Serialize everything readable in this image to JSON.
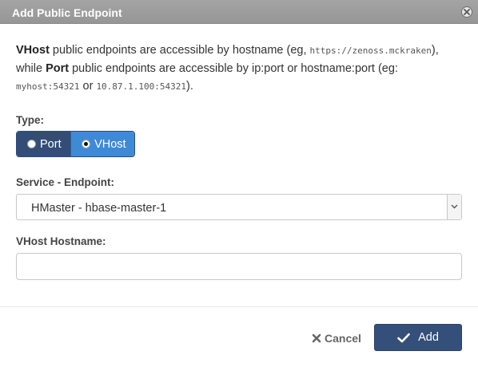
{
  "dialog": {
    "title": "Add Public Endpoint"
  },
  "intro": {
    "vhost_word": "VHost",
    "text1": " public endpoints are accessible by hostname (eg, ",
    "example_host": "https://zenoss.mckraken",
    "text2": "), while ",
    "port_word": "Port",
    "text3": " public endpoints are accessible by ip:port or hostname:port (eg: ",
    "example_port1": "myhost:54321",
    "text4": " or ",
    "example_port2": "10.87.1.100:54321",
    "text5": ")."
  },
  "type": {
    "label": "Type:",
    "options": [
      {
        "label": "Port",
        "selected": false
      },
      {
        "label": "VHost",
        "selected": true
      }
    ]
  },
  "service": {
    "label": "Service - Endpoint:",
    "selected": "HMaster - hbase-master-1"
  },
  "vhost_hostname": {
    "label": "VHost Hostname:",
    "value": "",
    "placeholder": ""
  },
  "footer": {
    "cancel_label": "Cancel",
    "add_label": "Add"
  },
  "colors": {
    "titlebar": "#9e9e9e",
    "primary": "#34507a",
    "selected_option": "#3f8ad6"
  },
  "icons": {
    "close": "close-icon",
    "cancel": "x-icon",
    "add": "checkmark-icon",
    "dropdown": "chevron-down-icon"
  }
}
